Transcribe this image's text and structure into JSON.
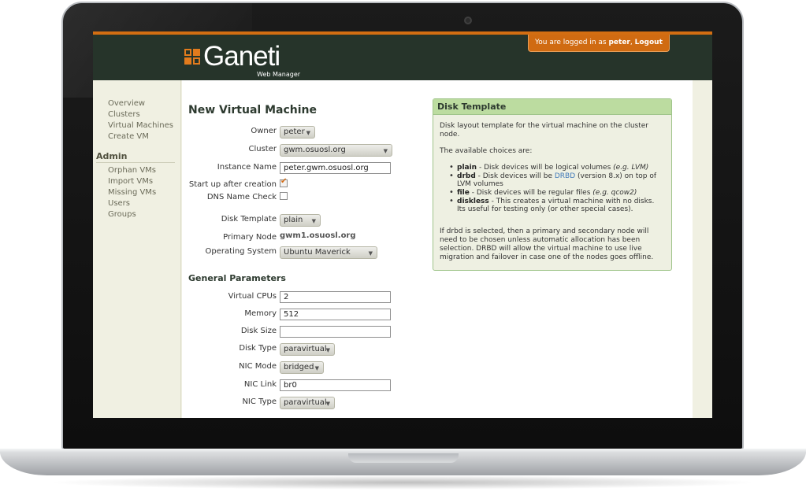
{
  "header": {
    "logo_text": "Ganeti",
    "logo_sub": "Web Manager",
    "login": {
      "prefix": "You are logged in as",
      "user": "peter",
      "separator": ",",
      "logout": "Logout"
    }
  },
  "sidebar": {
    "items": [
      "Overview",
      "Clusters",
      "Virtual Machines",
      "Create VM"
    ],
    "admin_heading": "Admin",
    "admin_items": [
      "Orphan VMs",
      "Import VMs",
      "Missing VMs",
      "Users",
      "Groups"
    ]
  },
  "form": {
    "title": "New Virtual Machine",
    "owner": {
      "label": "Owner",
      "value": "peter"
    },
    "cluster": {
      "label": "Cluster",
      "value": "gwm.osuosl.org"
    },
    "instance_name": {
      "label": "Instance Name",
      "value": "peter.gwm.osuosl.org"
    },
    "start_up": {
      "label": "Start up after creation",
      "checked": true
    },
    "dns_check": {
      "label": "DNS Name Check",
      "checked": false
    },
    "disk_template": {
      "label": "Disk Template",
      "value": "plain"
    },
    "primary_node": {
      "label": "Primary Node",
      "value": "gwm1.osuosl.org"
    },
    "os": {
      "label": "Operating System",
      "value": "Ubuntu Maverick"
    },
    "general_title": "General Parameters",
    "vcpus": {
      "label": "Virtual CPUs",
      "value": "2"
    },
    "memory": {
      "label": "Memory",
      "value": "512"
    },
    "disk_size": {
      "label": "Disk Size",
      "value": ""
    },
    "disk_type": {
      "label": "Disk Type",
      "value": "paravirtual"
    },
    "nic_mode": {
      "label": "NIC Mode",
      "value": "bridged"
    },
    "nic_link": {
      "label": "NIC Link",
      "value": "br0"
    },
    "nic_type": {
      "label": "NIC Type",
      "value": "paravirtual"
    }
  },
  "help": {
    "title": "Disk Template",
    "intro": "Disk layout template for the virtual machine on the cluster node.",
    "choices_intro": "The available choices are:",
    "choices": [
      {
        "name": "plain",
        "text": " - Disk devices will be logical volumes ",
        "note": "(e.g. LVM)"
      },
      {
        "name": "drbd",
        "text": " - Disk devices will be ",
        "link": "DRBD",
        "text2": " (version 8.x) on top of LVM volumes"
      },
      {
        "name": "file",
        "text": " - Disk devices will be regular files ",
        "note": "(e.g. qcow2)"
      },
      {
        "name": "diskless",
        "text": " - This creates a virtual machine with no disks. Its useful for testing only (or other special cases)."
      }
    ],
    "footer": "If drbd is selected, then a primary and secondary node will need to be chosen unless automatic allocation has been selection. DRBD will allow the virtual machine to use live migration and failover in case one of the nodes goes offline."
  },
  "colors": {
    "header_bg": "#26342a",
    "accent_orange": "#d36e12",
    "help_header": "#bcdca0",
    "link": "#3f78b8"
  }
}
